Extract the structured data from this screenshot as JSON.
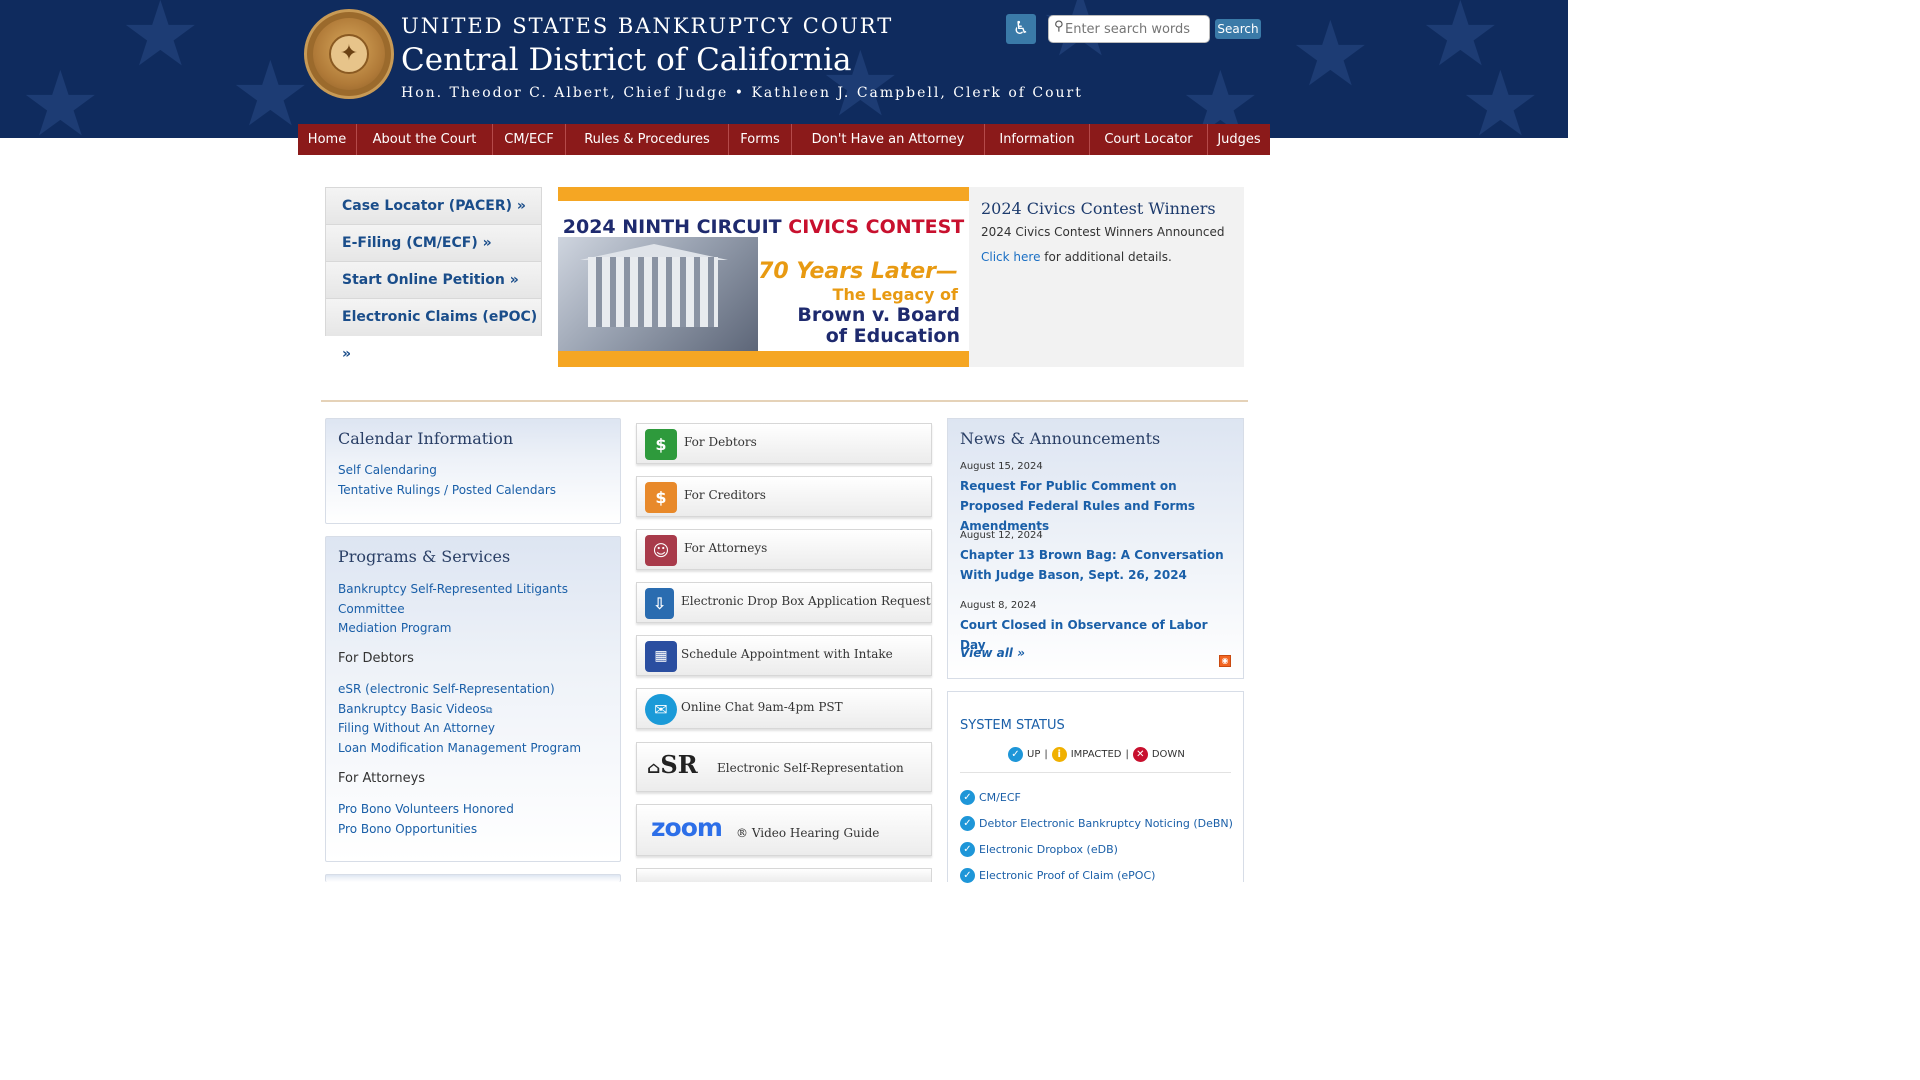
{
  "header": {
    "line1": "UNITED STATES BANKRUPTCY COURT",
    "line2": "Central District of California",
    "line3": "Hon. Theodor C. Albert, Chief Judge • Kathleen J. Campbell, Clerk of Court",
    "search_placeholder": "Enter search words",
    "search_button": "Search"
  },
  "nav": [
    "Home",
    "About the Court",
    "CM/ECF",
    "Rules & Procedures",
    "Forms",
    "Don't Have an Attorney",
    "Information",
    "Court Locator",
    "Judges"
  ],
  "quick_links": [
    "Case Locator (PACER) »",
    "E-Filing (CM/ECF) »",
    "Start Online Petition »",
    "Electronic Claims (ePOC) »"
  ],
  "banner": {
    "title_a": "2024 NINTH CIRCUIT ",
    "title_b": "CIVICS CONTEST",
    "sub1": "70 Years Later—",
    "sub2": "The Legacy of",
    "sub3a": "Brown v. Board",
    "sub3b": "of Education"
  },
  "civics": {
    "title": "2024 Civics Contest Winners",
    "text": "2024 Civics Contest Winners Announced",
    "link": "Click here",
    "suffix": " for additional details."
  },
  "calendar": {
    "title": "Calendar Information",
    "links": [
      "Self Calendaring",
      "Tentative Rulings / Posted Calendars"
    ]
  },
  "programs": {
    "title": "Programs & Services",
    "links_a": [
      "Bankruptcy Self-Represented Litigants",
      "Committee",
      "Mediation Program"
    ],
    "debtors_heading": "For Debtors",
    "links_b": [
      "eSR (electronic Self-Representation)",
      "Bankruptcy Basic Videos",
      "Filing Without An Attorney",
      "Loan Modification Management Program"
    ],
    "attorneys_heading": "For Attorneys",
    "links_c": [
      "Pro Bono Volunteers Honored",
      "Pro Bono Opportunities"
    ]
  },
  "tiles": [
    {
      "label": "For Debtors",
      "icon": "debtor-icon",
      "color": "#2e9a3c"
    },
    {
      "label": "For Creditors",
      "icon": "creditor-icon",
      "color": "#e8892a"
    },
    {
      "label": "For Attorneys",
      "icon": "attorney-icon",
      "color": "#a83a4a"
    },
    {
      "label": "Electronic Drop Box Application Request",
      "icon": "edb-icon",
      "color": "#2a6cb0"
    },
    {
      "label": "Schedule Appointment with Intake",
      "icon": "calendar-grid-icon",
      "color": "#2a4ea0"
    },
    {
      "label": "Online Chat 9am-4pm PST",
      "icon": "chat-icon",
      "color": "#1a9ad8"
    },
    {
      "label": "Electronic Self-Representation",
      "logo": "SR"
    },
    {
      "label": "® Video Hearing Guide",
      "logo": "zoom"
    }
  ],
  "news": {
    "title": "News & Announcements",
    "items": [
      {
        "date": "August 15, 2024",
        "title": "Request For Public Comment on Proposed Federal Rules and Forms Amendments"
      },
      {
        "date": "August 12, 2024",
        "title": "Chapter 13 Brown Bag: A Conversation With Judge Bason, Sept. 26, 2024"
      },
      {
        "date": "August 8, 2024",
        "title": "Court Closed in Observance of Labor Day"
      }
    ],
    "view_all": "View all »"
  },
  "status": {
    "title": "SYSTEM STATUS",
    "legend_up": "UP",
    "legend_impacted": "IMPACTED",
    "legend_down": "DOWN",
    "systems": [
      "CM/ECF",
      "Debtor Electronic Bankruptcy Noticing (DeBN)",
      "Electronic Dropbox (eDB)",
      "Electronic Proof of Claim (ePOC)"
    ]
  }
}
